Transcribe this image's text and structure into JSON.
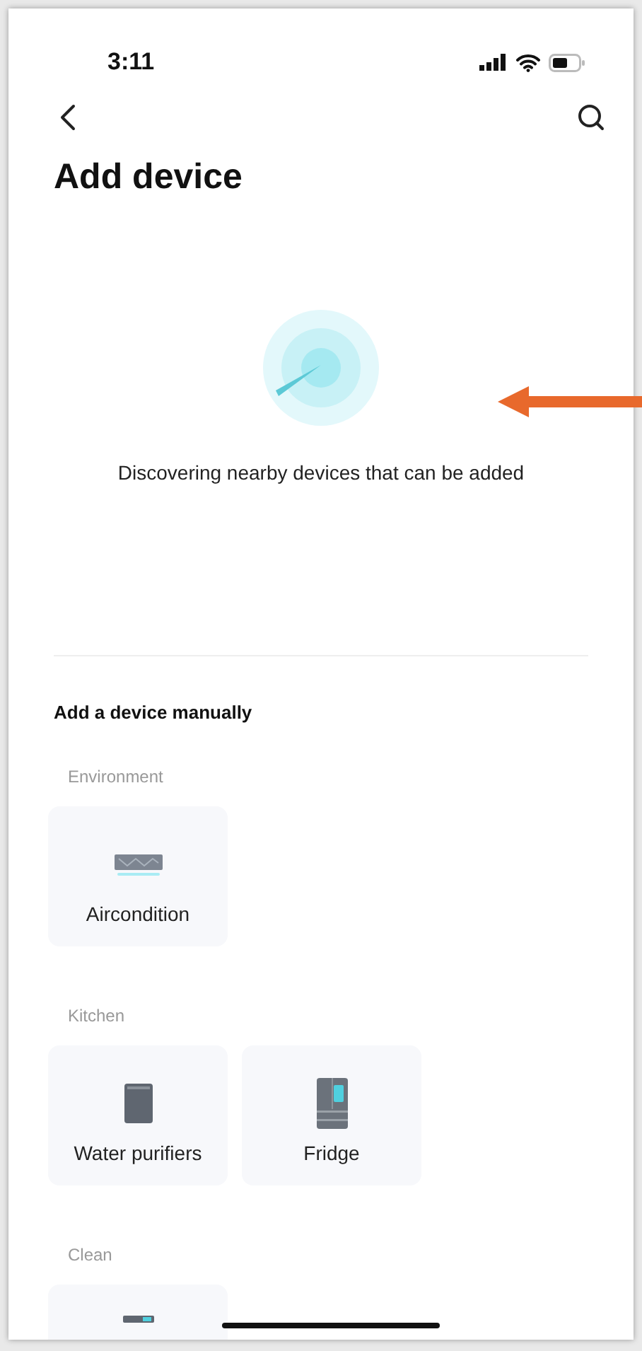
{
  "status_bar": {
    "time": "3:11"
  },
  "title": "Add device",
  "discovery": {
    "message": "Discovering nearby devices that can be added"
  },
  "manual_section": {
    "heading": "Add a device manually"
  },
  "categories": [
    {
      "name": "Environment",
      "devices": [
        {
          "kind": "aircon",
          "label": "Aircondition"
        }
      ]
    },
    {
      "name": "Kitchen",
      "devices": [
        {
          "kind": "purifier",
          "label": "Water purifiers"
        },
        {
          "kind": "fridge",
          "label": "Fridge"
        }
      ]
    },
    {
      "name": "Clean",
      "devices": [
        {
          "kind": "cleaner"
        }
      ]
    }
  ]
}
